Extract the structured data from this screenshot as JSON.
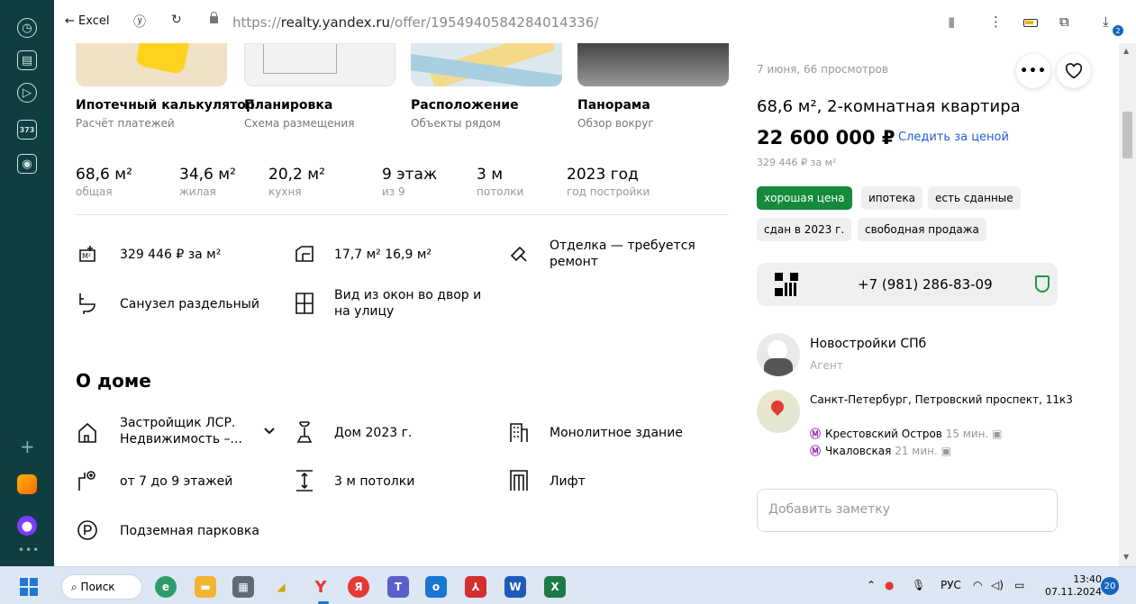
{
  "browser": {
    "back_label": "← Excel",
    "url_base": "https://",
    "url_host": "realty.yandex.ru",
    "url_path": "/offer/1954940584284014336/",
    "downloads_count": "2"
  },
  "sidebar": {
    "badge": "373"
  },
  "tiles": [
    {
      "title": "Ипотечный калькулятор",
      "subtitle": "Расчёт платежей"
    },
    {
      "title": "Планировка",
      "subtitle": "Схема размещения"
    },
    {
      "title": "Расположение",
      "subtitle": "Объекты рядом"
    },
    {
      "title": "Панорама",
      "subtitle": "Обзор вокруг"
    }
  ],
  "stats": [
    {
      "value": "68,6 м²",
      "label": "общая"
    },
    {
      "value": "34,6 м²",
      "label": "жилая"
    },
    {
      "value": "20,2 м²",
      "label": "кухня"
    },
    {
      "value": "9 этаж",
      "label": "из 9"
    },
    {
      "value": "3 м",
      "label": "потолки"
    },
    {
      "value": "2023 год",
      "label": "год постройки"
    }
  ],
  "features": {
    "price_per_m2": "329 446 ₽ за м²",
    "rooms": "17,7 м² 16,9 м²",
    "finish": "Отделка — требуется ремонт",
    "bathroom": "Санузел раздельный",
    "view": "Вид из окон во двор и на улицу"
  },
  "house": {
    "heading": "О доме",
    "developer": "Застройщик ЛСР. Недвижимость –...",
    "built": "Дом 2023 г.",
    "type": "Монолитное здание",
    "floors": "от 7 до 9 этажей",
    "ceilings": "3 м потолки",
    "lift": "Лифт",
    "parking": "Подземная парковка"
  },
  "offer": {
    "meta": "7 июня, 66 просмотров",
    "title": "68,6 м², 2-комнатная квартира",
    "price": "22 600 000 ₽",
    "follow_label": "Следить за ценой",
    "price_per_m2": "329 446 ₽ за м²",
    "tags": [
      "хорошая цена",
      "ипотека",
      "есть сданные",
      "сдан в 2023 г.",
      "свободная продажа"
    ],
    "phone": "+7 (981) 286-83-09",
    "agent_name": "Новостройки СПб",
    "agent_role": "Агент",
    "address": "Санкт-Петербург, Петровский проспект, 11к3",
    "metro": [
      {
        "symbol": "Ⓜ",
        "name": "Крестовский Остров",
        "time": "15 мин."
      },
      {
        "symbol": "Ⓜ",
        "name": "Чкаловская",
        "time": "21 мин."
      }
    ],
    "note_placeholder": "Добавить заметку"
  },
  "taskbar": {
    "search_label": "Поиск",
    "lang": "РУС",
    "time": "13:40",
    "date": "07.11.2024",
    "notifications": "20"
  }
}
